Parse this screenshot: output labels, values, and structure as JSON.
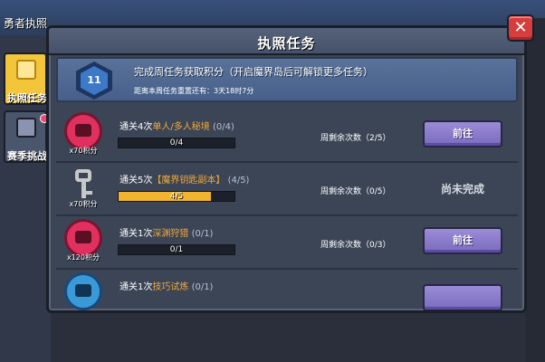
{
  "background": {
    "title": "勇者执照",
    "tabs": [
      {
        "label": "执照任务"
      },
      {
        "label": "赛季挑战"
      }
    ]
  },
  "dialog": {
    "title": "执照任务",
    "close_label": "✕",
    "banner": {
      "level": "11",
      "text": "完成周任务获取积分（开启魔界岛后可解锁更多任务）",
      "subtext": "距离本周任务重置还有：3天18时7分"
    },
    "tasks": [
      {
        "prefix": "通关4次",
        "highlight": "单人/多人秘境",
        "count": "(0/4)",
        "points": "x70积分",
        "progress_text": "0/4",
        "progress": 0,
        "weekly": "周剩余次数（2/5）",
        "action": "前往",
        "icon": "dungeon-icon"
      },
      {
        "prefix": "通关5次",
        "highlight": "【魔界钥匙副本】",
        "count": "(4/5)",
        "points": "x70积分",
        "progress_text": "4/5",
        "progress": 0.8,
        "weekly": "周剩余次数（0/5）",
        "status": "尚未完成",
        "icon": "key-icon"
      },
      {
        "prefix": "通关1次",
        "highlight": "深渊狩猎",
        "count": "(0/1)",
        "points": "x120积分",
        "progress_text": "0/1",
        "progress": 0,
        "weekly": "周剩余次数（0/3）",
        "action": "前往",
        "icon": "abyss-icon"
      },
      {
        "prefix": "通关1次",
        "highlight": "技巧试炼",
        "count": "(0/1)",
        "icon": "trial-icon"
      }
    ]
  },
  "colors": {
    "highlight": "#f3a83a",
    "button": "#8a7bcb",
    "progress_fill": "#f0b42e",
    "close_button": "#d63d3d"
  }
}
